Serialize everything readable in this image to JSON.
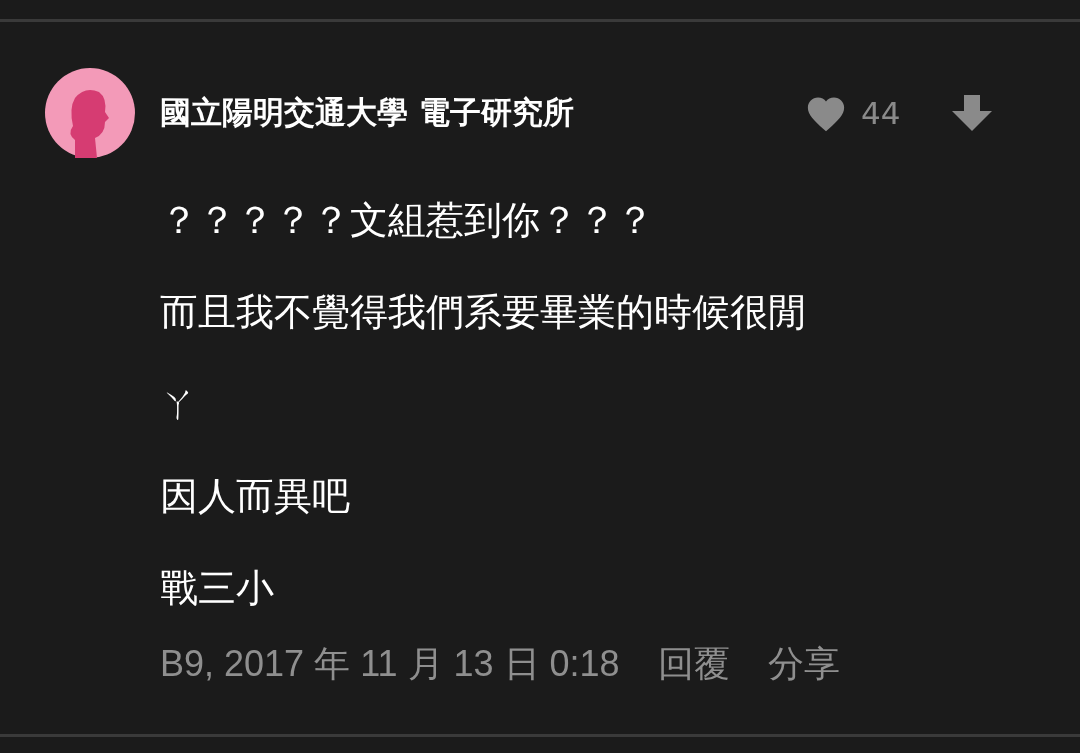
{
  "comment": {
    "author": "國立陽明交通大學 電子研究所",
    "likes": "44",
    "lines": [
      "？？？？？文組惹到你？？？",
      "而且我不覺得我們系要畢業的時候很閒",
      "ㄚ",
      "因人而異吧",
      "戰三小"
    ],
    "meta": "B9, 2017 年 11 月 13 日 0:18",
    "actions": [
      "回覆",
      "分享"
    ]
  }
}
